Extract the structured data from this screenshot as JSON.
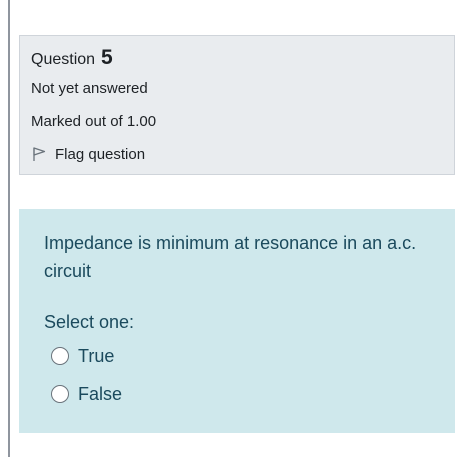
{
  "info": {
    "question_label": "Question",
    "question_number": "5",
    "status": "Not yet answered",
    "marks": "Marked out of 1.00",
    "flag_label": "Flag question",
    "flag_icon": "flag-icon"
  },
  "question": {
    "text": "Impedance is minimum at resonance in an a.c. circuit",
    "prompt": "Select one:",
    "options": [
      {
        "label": "True",
        "selected": false
      },
      {
        "label": "False",
        "selected": false
      }
    ]
  },
  "colors": {
    "info_bg": "#e9ecef",
    "question_bg": "#cfe8ec",
    "question_text": "#1b4a5d"
  }
}
